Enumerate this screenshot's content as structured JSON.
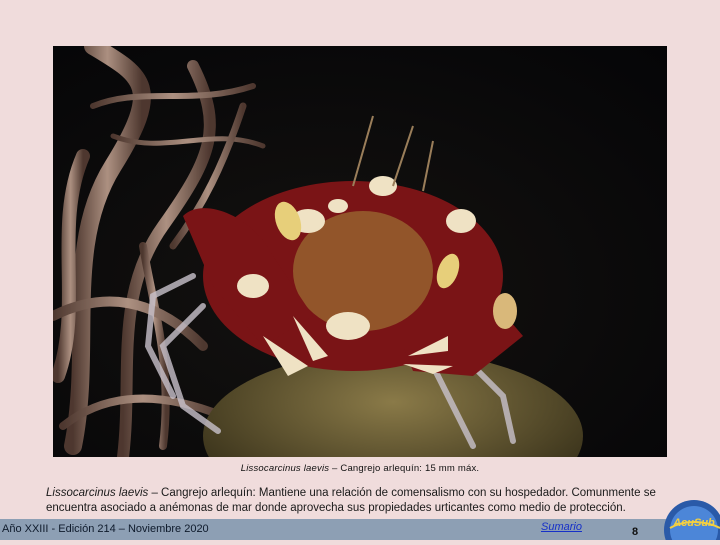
{
  "photo": {
    "subject": "harlequin crab on sea anemone",
    "colors": {
      "background": "#07070a",
      "crab_red": "#7a1416",
      "crab_cream": "#efe2c4",
      "anemone": "#8a6a58"
    }
  },
  "caption": {
    "species": "Lissocarcinus laevis",
    "rest": " – Cangrejo arlequín: 15 mm máx."
  },
  "description": {
    "species": "Lissocarcinus laevis",
    "rest": " – Cangrejo arlequín: Mantiene una relación de comensalismo con su hospedador. Comunmente se encuentra asociado a anémonas de mar donde aprovecha sus propiedades urticantes como medio de protección."
  },
  "footer": {
    "edition": "Año XXIII - Edición 214 – Noviembre 2020",
    "sumario_link": "Sumario",
    "page_number": "8",
    "logo_text": "AcuSub",
    "bar_color": "#8d9fb4"
  }
}
